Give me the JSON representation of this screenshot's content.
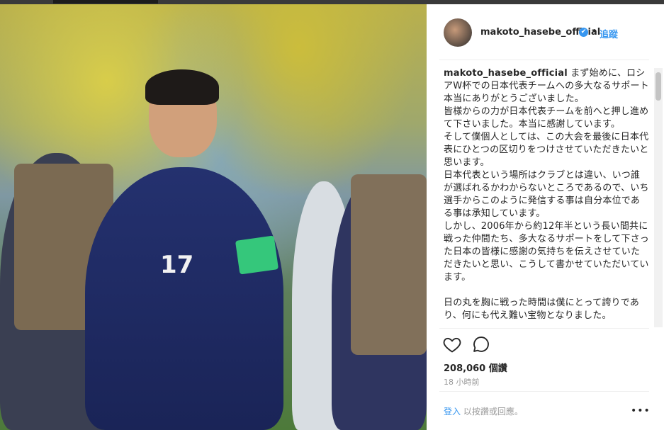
{
  "header": {
    "username": "makoto_hasebe_official",
    "verified_mark": "✔",
    "separator": "•",
    "follow_label": "追蹤"
  },
  "caption": {
    "username": "makoto_hasebe_official",
    "text": "まず始めに、ロシアW杯での日本代表チームへの多大なるサポート本当にありがとうございました。\n皆様からの力が日本代表チームを前へと押し進めて下さいました。本当に感謝しています。\nそして僕個人としては、この大会を最後に日本代表にひとつの区切りをつけさせていただきたいと思います。\n日本代表という場所はクラブとは違い、いつ誰が選ばれるかわからないところであるので、いち選手からこのように発信する事は自分本位である事は承知しています。\nしかし、2006年から約12年半という長い間共に戦った仲間たち、多大なるサポートをして下さった日本の皆様に感謝の気持ちを伝えさせていただきたいと思い、こうして書かせていただいています。\n\n日の丸を胸に戦った時間は僕にとって誇りであり、何にも代え難い宝物となりました。"
  },
  "photo": {
    "jersey_number": "17"
  },
  "actions": {
    "like_icon": "heart-icon",
    "comment_icon": "comment-icon"
  },
  "stats": {
    "likes": "208,060 個讚",
    "timestamp": "18 小時前"
  },
  "footer": {
    "login_link": "登入",
    "login_text": " 以按讚或回應。",
    "more": "•••"
  },
  "colors": {
    "accent": "#3897f0",
    "text": "#262626",
    "muted": "#999999",
    "armband": "#35c77b",
    "jersey": "#24316f"
  }
}
